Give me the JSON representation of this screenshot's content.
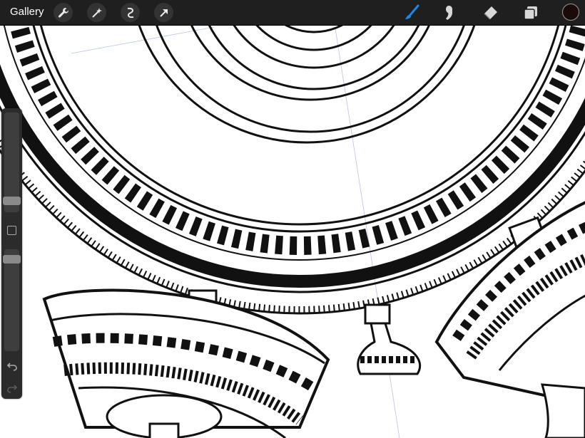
{
  "app": {
    "gallery_label": "Gallery"
  },
  "toolbar": {
    "left_tools": [
      "wrench-icon",
      "magic-wand-icon",
      "selection-icon",
      "transform-arrow-icon"
    ],
    "right_tools": [
      "brush-icon",
      "smudge-icon",
      "eraser-icon",
      "layers-icon"
    ],
    "active_tool": "brush-icon",
    "active_color": "#1a0b09",
    "brush_color": "#1e88e5"
  },
  "sidebar": {
    "brush_size_level": 0.66,
    "opacity_level": 0.06
  }
}
